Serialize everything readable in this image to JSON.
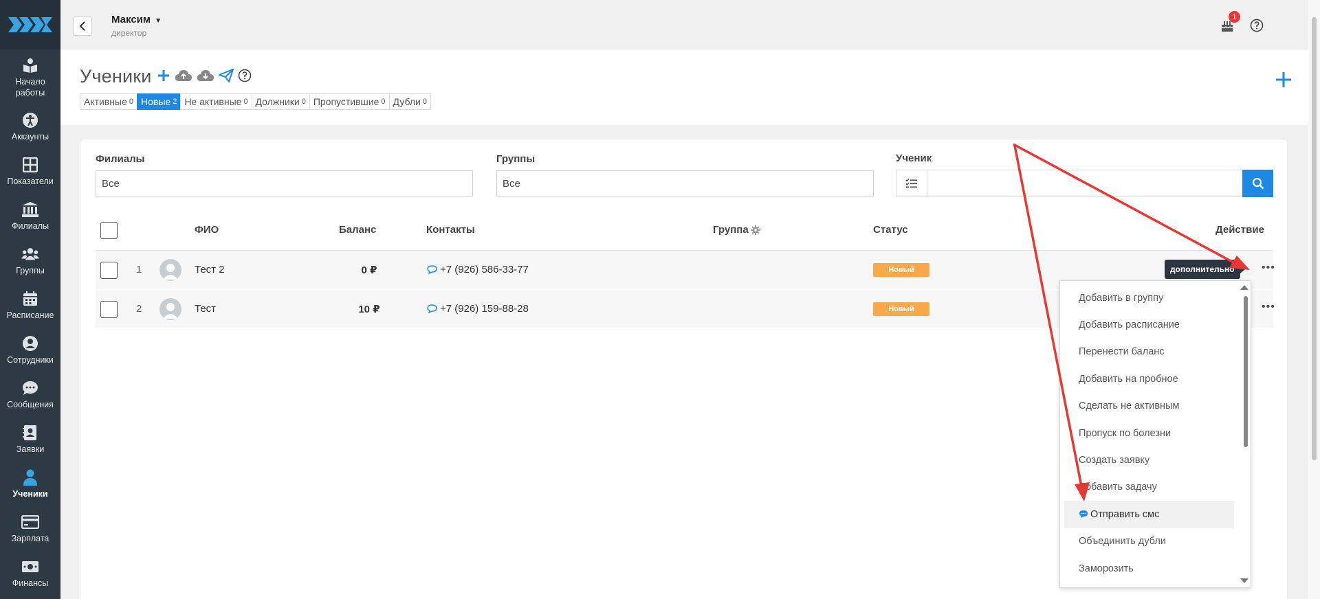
{
  "sidebar": {
    "items": [
      {
        "label": "Начало работы",
        "icon": "book-reader-icon"
      },
      {
        "label": "Аккаунты",
        "icon": "accessibility-icon"
      },
      {
        "label": "Показатели",
        "icon": "grid-icon"
      },
      {
        "label": "Филиалы",
        "icon": "bank-icon"
      },
      {
        "label": "Группы",
        "icon": "users-icon"
      },
      {
        "label": "Расписание",
        "icon": "calendar-icon"
      },
      {
        "label": "Сотрудники",
        "icon": "user-circle-icon"
      },
      {
        "label": "Сообщения",
        "icon": "chat-icon"
      },
      {
        "label": "Заявки",
        "icon": "address-book-icon"
      },
      {
        "label": "Ученики",
        "icon": "user-icon"
      },
      {
        "label": "Зарплата",
        "icon": "credit-card-icon"
      },
      {
        "label": "Финансы",
        "icon": "money-icon"
      }
    ],
    "active": "Ученики"
  },
  "topbar": {
    "user_name": "Максим",
    "user_role": "директор",
    "notifications_count": "1"
  },
  "page": {
    "title": "Ученики",
    "tabs": [
      {
        "label": "Активные",
        "count": "0"
      },
      {
        "label": "Новые",
        "count": "2"
      },
      {
        "label": "Не активные",
        "count": "0"
      },
      {
        "label": "Должники",
        "count": "0"
      },
      {
        "label": "Пропустившие",
        "count": "0"
      },
      {
        "label": "Дубли",
        "count": "0"
      }
    ],
    "active_tab": "Новые"
  },
  "filters": {
    "branches_label": "Филиалы",
    "branches_value": "Все",
    "groups_label": "Группы",
    "groups_value": "Все",
    "student_label": "Ученик",
    "student_value": ""
  },
  "table": {
    "headers": {
      "name": "ФИО",
      "balance": "Баланс",
      "contacts": "Контакты",
      "group": "Группа",
      "status": "Статус",
      "action": "Действие"
    },
    "rows": [
      {
        "num": "1",
        "name": "Тест 2",
        "balance": "0 ₽",
        "phone": "+7 (926) 586-33-77",
        "group": "",
        "status": "Новый"
      },
      {
        "num": "2",
        "name": "Тест",
        "balance": "10 ₽",
        "phone": "+7 (926) 159-88-28",
        "group": "",
        "status": "Новый"
      }
    ]
  },
  "tooltip": "дополнительно",
  "dropdown": {
    "items": [
      "Добавить в группу",
      "Добавить расписание",
      "Перенести баланс",
      "Добавить на пробное",
      "Сделать не активным",
      "Пропуск по болезни",
      "Создать заявку",
      "Добавить задачу",
      "Отправить смс",
      "Объединить дубли",
      "Заморозить"
    ],
    "highlighted": "Отправить смс"
  },
  "colors": {
    "sidebar": "#2d3a44",
    "accent": "#1e88e5",
    "status_new": "#f7a94b",
    "annotation_arrow": "#e53935"
  }
}
